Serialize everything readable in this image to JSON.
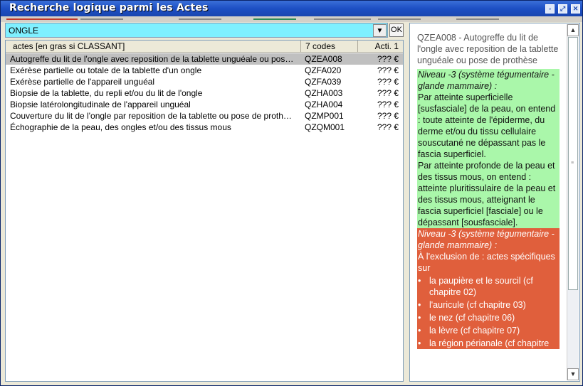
{
  "window": {
    "title": "Recherche logique parmi les Actes",
    "controls": [
      "restore-icon",
      "maximize-icon",
      "close-icon"
    ]
  },
  "search": {
    "value": "ONGLE",
    "ok_label": "OK"
  },
  "table": {
    "headers": [
      "actes [en gras si CLASSANT]",
      "7 codes",
      "Acti. 1"
    ],
    "rows": [
      {
        "label": "Autogreffe du lit de l'ongle avec reposition de la tablette unguéale ou pos…",
        "code": "QZEA008",
        "price": "??? €"
      },
      {
        "label": "Exérèse partielle ou totale de la tablette d'un ongle",
        "code": "QZFA020",
        "price": "??? €"
      },
      {
        "label": "Exérèse partielle de l'appareil unguéal",
        "code": "QZFA039",
        "price": "??? €"
      },
      {
        "label": "Biopsie de la tablette, du repli et/ou du lit de l'ongle",
        "code": "QZHA003",
        "price": "??? €"
      },
      {
        "label": "Biopsie latérolongitudinale de l'appareil unguéal",
        "code": "QZHA004",
        "price": "??? €"
      },
      {
        "label": "Couverture du lit de l'ongle par reposition de la tablette ou pose de proth…",
        "code": "QZMP001",
        "price": "??? €"
      },
      {
        "label": "Échographie de la peau, des ongles et/ou des tissus mous",
        "code": "QZQM001",
        "price": "??? €"
      }
    ],
    "selected_index": 0
  },
  "detail": {
    "intro": "QZEA008 - Autogreffe du lit de l'ongle avec reposition de la tablette unguéale ou pose de prothèse",
    "green_heading": "Niveau -3 (système tégumentaire - glande mammaire) :",
    "green_p1": "Par atteinte superficielle [susfasciale] de la peau, on entend : toute atteinte de l'épiderme, du derme et/ou du tissu cellulaire souscutané ne dépassant pas le fascia superficiel.",
    "green_p2": "Par atteinte profonde de la peau et des tissus mous, on entend : atteinte pluritissulaire de la peau et des tissus mous, atteignant le fascia superficiel [fasciale] ou le dépassant [sousfasciale].",
    "red_heading": "Niveau -3 (système tégumentaire - glande mammaire) :",
    "red_p1": "À l'exclusion de : actes spécifiques sur",
    "red_bullets": [
      "la paupière et le sourcil (cf chapitre 02)",
      "l'auricule (cf chapitre 03)",
      "le nez (cf chapitre 06)",
      "la lèvre (cf chapitre 07)",
      "la région périanale (cf chapitre"
    ],
    "bullet_glyph": "•"
  },
  "colors": {
    "search_bg": "#7ff0ff",
    "green_block": "#aaf7aa",
    "red_block": "#e05f3c",
    "selection": "#c0c0c0"
  }
}
